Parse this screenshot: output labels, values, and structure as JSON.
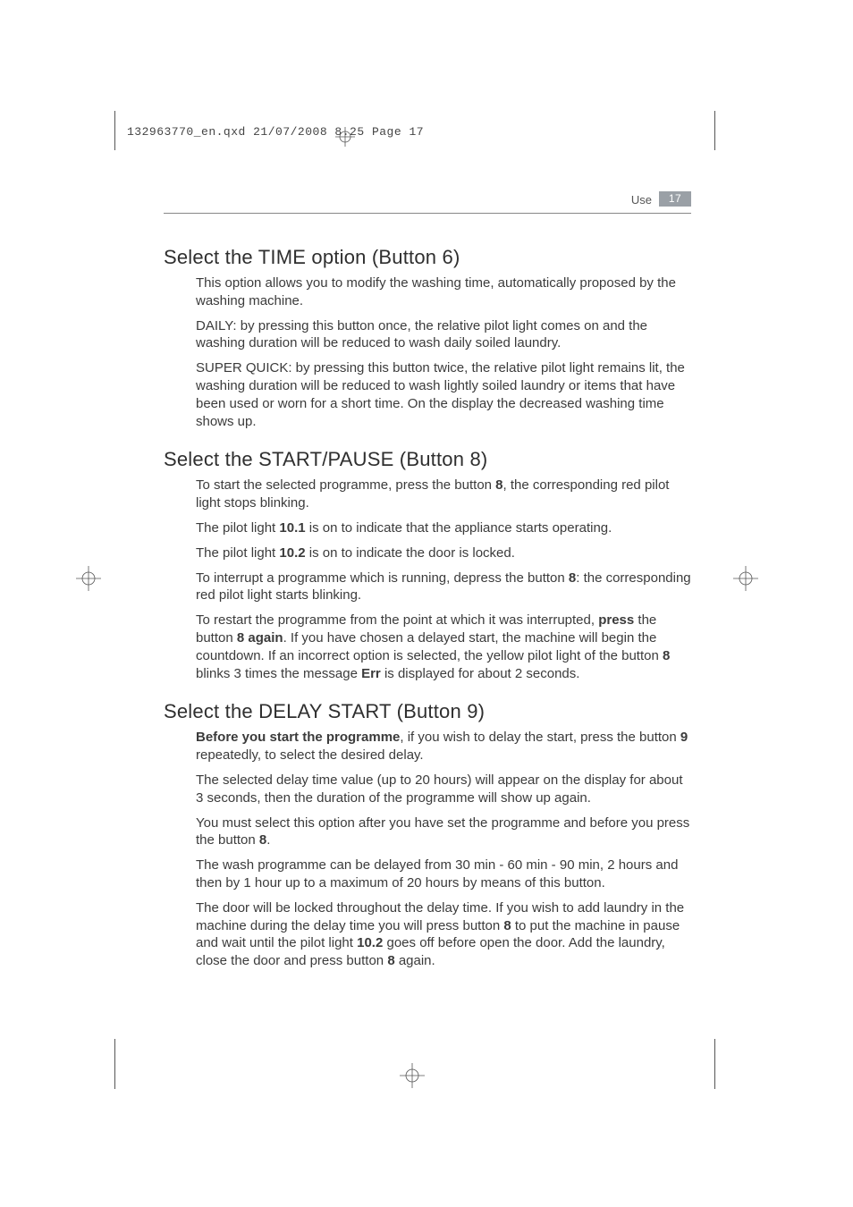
{
  "slug": "132963770_en.qxd  21/07/2008  8.25  Page 17",
  "header": {
    "section": "Use",
    "page": "17"
  },
  "sections": [
    {
      "title": "Select the TIME option (Button 6)",
      "paragraphs": [
        {
          "runs": [
            {
              "t": "This option allows you to modify the washing time, automatically proposed by the washing machine."
            }
          ]
        },
        {
          "runs": [
            {
              "t": "DAILY: by pressing this button once, the relative pilot light comes on and the washing duration will be reduced to wash daily soiled laundry."
            }
          ]
        },
        {
          "runs": [
            {
              "t": "SUPER QUICK: by pressing this button twice, the relative pilot light remains lit, the washing duration will be reduced to wash lightly soiled laundry or items that have been used or worn for a short time. On the display the decreased washing time shows up."
            }
          ]
        }
      ]
    },
    {
      "title": "Select the START/PAUSE (Button 8)",
      "paragraphs": [
        {
          "runs": [
            {
              "t": "To start the selected programme, press the button "
            },
            {
              "t": "8",
              "b": true
            },
            {
              "t": ", the corresponding red pilot light stops blinking."
            }
          ]
        },
        {
          "runs": [
            {
              "t": "The pilot light "
            },
            {
              "t": "10.1",
              "b": true
            },
            {
              "t": " is on to indicate that the appliance starts operating."
            }
          ]
        },
        {
          "runs": [
            {
              "t": "The pilot light "
            },
            {
              "t": "10.2",
              "b": true
            },
            {
              "t": " is on to indicate the door is locked."
            }
          ]
        },
        {
          "runs": [
            {
              "t": "To interrupt a programme which is running, depress the button "
            },
            {
              "t": "8",
              "b": true
            },
            {
              "t": ": the corresponding red pilot light starts blinking."
            }
          ]
        },
        {
          "runs": [
            {
              "t": "To restart the programme from the point at which it was interrupted, "
            },
            {
              "t": "press",
              "b": true
            },
            {
              "t": " the button "
            },
            {
              "t": "8 again",
              "b": true
            },
            {
              "t": ". If you have chosen a delayed start, the machine will begin the countdown. If an incorrect option is selected, the yellow pilot light of the button "
            },
            {
              "t": "8",
              "b": true
            },
            {
              "t": " blinks 3 times the message "
            },
            {
              "t": "Err",
              "b": true
            },
            {
              "t": " is displayed for about 2 seconds."
            }
          ]
        }
      ]
    },
    {
      "title": "Select the DELAY START (Button 9)",
      "paragraphs": [
        {
          "runs": [
            {
              "t": "Before you start the programme",
              "b": true
            },
            {
              "t": ", if you wish to delay the start, press the button "
            },
            {
              "t": "9",
              "b": true
            },
            {
              "t": " repeatedly, to select the desired delay."
            }
          ]
        },
        {
          "runs": [
            {
              "t": "The selected delay time value (up to 20 hours) will appear on the display for about 3 seconds, then the duration of the programme will show up again."
            }
          ]
        },
        {
          "runs": [
            {
              "t": "You must select this option after you have set the programme and before you press the button "
            },
            {
              "t": "8",
              "b": true
            },
            {
              "t": "."
            }
          ]
        },
        {
          "runs": [
            {
              "t": "The wash programme can be delayed from 30 min - 60 min - 90 min, 2 hours and then by 1 hour up to a maximum of 20 hours by means of this button."
            }
          ]
        },
        {
          "runs": [
            {
              "t": "The door will be locked throughout the delay time. If you wish to add laundry in the machine during the delay time you will press button "
            },
            {
              "t": "8",
              "b": true
            },
            {
              "t": " to put the machine in pause and wait until the pilot light "
            },
            {
              "t": "10.2",
              "b": true
            },
            {
              "t": " goes off before open the door. Add the laundry, close the door and press button "
            },
            {
              "t": "8",
              "b": true
            },
            {
              "t": " again."
            }
          ]
        }
      ]
    }
  ]
}
